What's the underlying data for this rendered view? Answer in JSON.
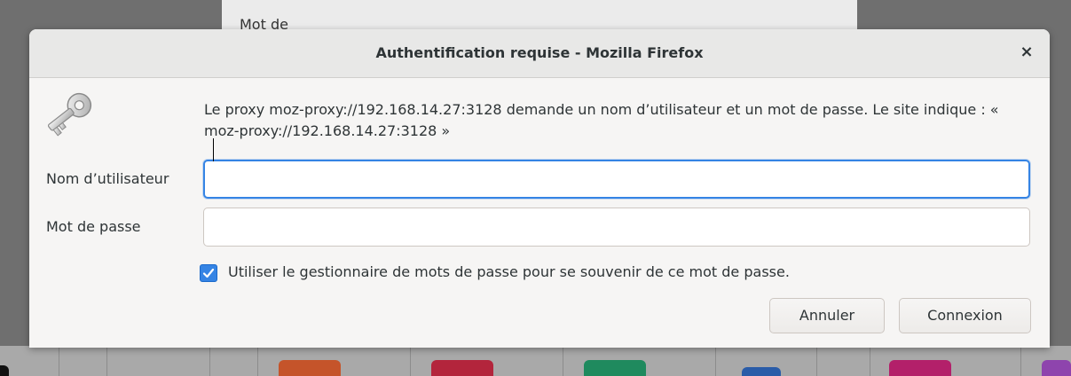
{
  "background": {
    "window_title_fragment": "Mot de"
  },
  "dialog": {
    "title": "Authentification requise - Mozilla Firefox",
    "close_label": "×",
    "icon": "key-icon",
    "message": "Le proxy moz-proxy://192.168.14.27:3128 demande un nom d’utilisateur et un mot de passe. Le site indique : « moz-proxy://192.168.14.27:3128 »",
    "username": {
      "label": "Nom d’utilisateur",
      "value": ""
    },
    "password": {
      "label": "Mot de passe",
      "value": ""
    },
    "remember": {
      "label": "Utiliser le gestionnaire de mots de passe pour se souvenir de ce mot de passe.",
      "checked": true
    },
    "buttons": {
      "cancel": "Annuler",
      "connect": "Connexion"
    }
  },
  "colors": {
    "accent": "#3584e4",
    "dialog_bg": "#f6f5f4",
    "titlebar_bg": "#e8e8e7",
    "text": "#2e3436"
  },
  "dock": {
    "tile_colors": [
      "#c5542a",
      "#b3253c",
      "#1f8a5e",
      "#2a5ca8",
      "#b3206a",
      "#8e44ad"
    ]
  }
}
